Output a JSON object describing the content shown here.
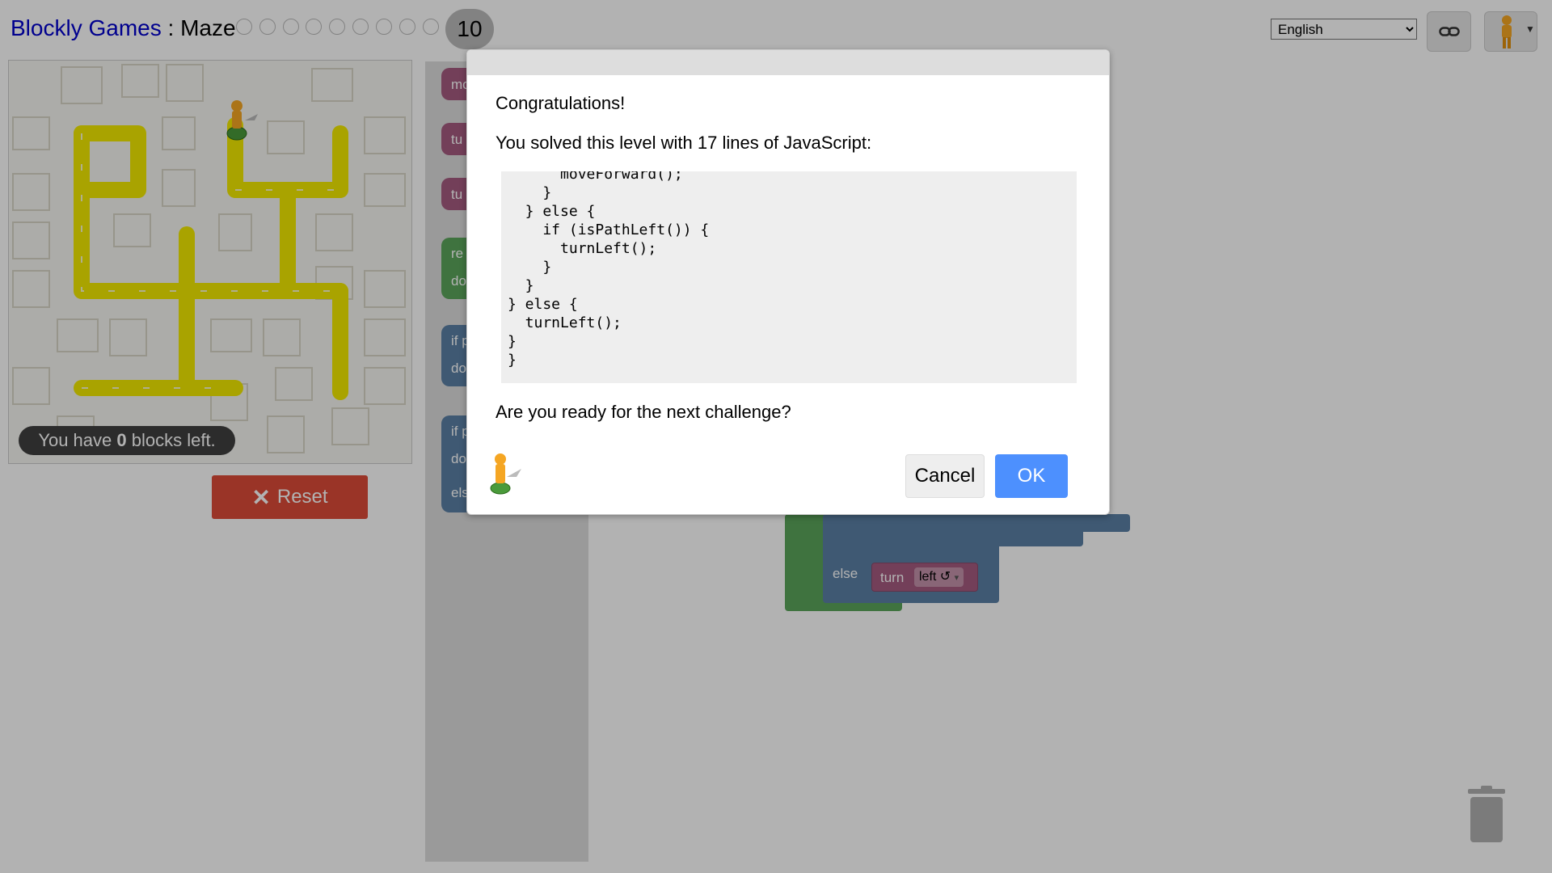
{
  "header": {
    "app_link": "Blockly Games",
    "separator": " : ",
    "game": "Maze",
    "current_level": "10",
    "language": "English"
  },
  "maze": {
    "blocks_left_prefix": "You have ",
    "blocks_left_count": "0",
    "blocks_left_suffix": " blocks left."
  },
  "reset": {
    "icon": "x-icon",
    "label": "Reset"
  },
  "toolbox": {
    "blocks": [
      "mo",
      "tu",
      "tu",
      "re",
      "do",
      "if p",
      "do",
      "if p",
      "do",
      "els"
    ]
  },
  "workspace": {
    "else_label": "else",
    "turn_label": "turn",
    "turn_dir": "left ↺",
    "dropdown_arrow": "▾"
  },
  "dialog": {
    "title": "Congratulations!",
    "message": "You solved this level with 17 lines of JavaScript:",
    "code": [
      "      moveForward();",
      "    }",
      "  } else {",
      "    if (isPathLeft()) {",
      "      turnLeft();",
      "    }",
      "  }",
      "} else {",
      "  turnLeft();",
      "}",
      "}"
    ],
    "question": "Are you ready for the next challenge?",
    "cancel_label": "Cancel",
    "ok_label": "OK"
  },
  "colors": {
    "path": "#f2ea00",
    "reset": "#dd4b39",
    "ok": "#4d90fe",
    "loop_block": "#5ba55b",
    "if_block": "#5b80a5",
    "action_block": "#a55b80"
  }
}
